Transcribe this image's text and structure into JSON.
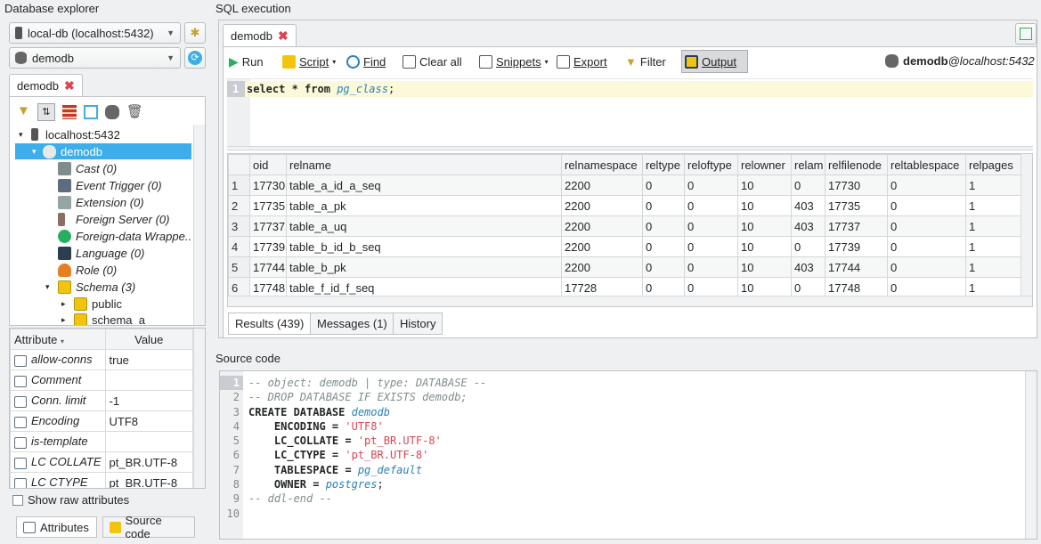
{
  "explorer": {
    "title": "Database explorer",
    "connection": "local-db (localhost:5432)",
    "database": "demodb",
    "tab_label": "demodb",
    "tree": [
      {
        "label": "localhost:5432",
        "italic": false
      },
      {
        "label": "demodb",
        "italic": false
      },
      {
        "label": "Cast (0)",
        "italic": true
      },
      {
        "label": "Event Trigger (0)",
        "italic": true
      },
      {
        "label": "Extension (0)",
        "italic": true
      },
      {
        "label": "Foreign Server (0)",
        "italic": true
      },
      {
        "label": "Foreign-data Wrappe...",
        "italic": true
      },
      {
        "label": "Language (0)",
        "italic": true
      },
      {
        "label": "Role (0)",
        "italic": true
      },
      {
        "label": "Schema (3)",
        "italic": true
      },
      {
        "label": "public",
        "italic": false
      },
      {
        "label": "schema_a",
        "italic": false
      }
    ],
    "attr_header": {
      "attribute": "Attribute",
      "value": "Value"
    },
    "attributes": [
      {
        "k": "allow-conns",
        "v": "true"
      },
      {
        "k": "Comment",
        "v": ""
      },
      {
        "k": "Conn. limit",
        "v": "-1"
      },
      {
        "k": "Encoding",
        "v": "UTF8"
      },
      {
        "k": "is-template",
        "v": ""
      },
      {
        "k": "LC COLLATE",
        "v": "pt_BR.UTF-8"
      },
      {
        "k": "LC CTYPE",
        "v": "pt_BR.UTF-8"
      }
    ],
    "show_raw": "Show raw attributes",
    "bottom_tabs": {
      "attributes": "Attributes",
      "source": "Source code"
    }
  },
  "sql": {
    "title": "SQL execution",
    "tab_label": "demodb",
    "toolbar": {
      "run": "Run",
      "script": "Script",
      "find": "Find",
      "clear": "Clear all",
      "snippets": "Snippets",
      "export": "Export",
      "filter": "Filter",
      "output": "Output"
    },
    "conn_db": "demodb",
    "conn_host": "@localhost:5432",
    "query": {
      "kw1": "select",
      "star": " * ",
      "kw2": "from",
      "table": "pg_class",
      "end": ";"
    },
    "columns": [
      "oid",
      "relname",
      "relnamespace",
      "reltype",
      "reloftype",
      "relowner",
      "relam",
      "relfilenode",
      "reltablespace",
      "relpages"
    ],
    "rows": [
      [
        "1",
        "17730",
        "table_a_id_a_seq",
        "2200",
        "0",
        "0",
        "10",
        "0",
        "17730",
        "0",
        "1"
      ],
      [
        "2",
        "17735",
        "table_a_pk",
        "2200",
        "0",
        "0",
        "10",
        "403",
        "17735",
        "0",
        "1"
      ],
      [
        "3",
        "17737",
        "table_a_uq",
        "2200",
        "0",
        "0",
        "10",
        "403",
        "17737",
        "0",
        "1"
      ],
      [
        "4",
        "17739",
        "table_b_id_b_seq",
        "2200",
        "0",
        "0",
        "10",
        "0",
        "17739",
        "0",
        "1"
      ],
      [
        "5",
        "17744",
        "table_b_pk",
        "2200",
        "0",
        "0",
        "10",
        "403",
        "17744",
        "0",
        "1"
      ],
      [
        "6",
        "17748",
        "table_f_id_f_seq",
        "17728",
        "0",
        "0",
        "10",
        "0",
        "17748",
        "0",
        "1"
      ]
    ],
    "result_tabs": {
      "results": "Results (439)",
      "messages": "Messages (1)",
      "history": "History"
    }
  },
  "source": {
    "title": "Source code",
    "lines": [
      {
        "n": "1"
      },
      {
        "n": "2"
      },
      {
        "n": "3"
      },
      {
        "n": "4"
      },
      {
        "n": "5"
      },
      {
        "n": "6"
      },
      {
        "n": "7"
      },
      {
        "n": "8"
      },
      {
        "n": "9"
      },
      {
        "n": "10"
      }
    ],
    "l1": "-- object: demodb | type: DATABASE --",
    "l2": "-- DROP DATABASE IF EXISTS demodb;",
    "l3k": "CREATE DATABASE ",
    "l3v": "demodb",
    "l4k": "    ENCODING = ",
    "l4v": "'UTF8'",
    "l5k": "    LC_COLLATE = ",
    "l5v": "'pt_BR.UTF-8'",
    "l6k": "    LC_CTYPE = ",
    "l6v": "'pt_BR.UTF-8'",
    "l7k": "    TABLESPACE = ",
    "l7v": "pg_default",
    "l8k": "    OWNER = ",
    "l8v": "postgres",
    "l8e": ";",
    "l9": "-- ddl-end --"
  },
  "colors": {
    "accent": "#3daee9",
    "comment": "#7f8c8d",
    "string": "#da4453",
    "ident": "#2980b9"
  }
}
